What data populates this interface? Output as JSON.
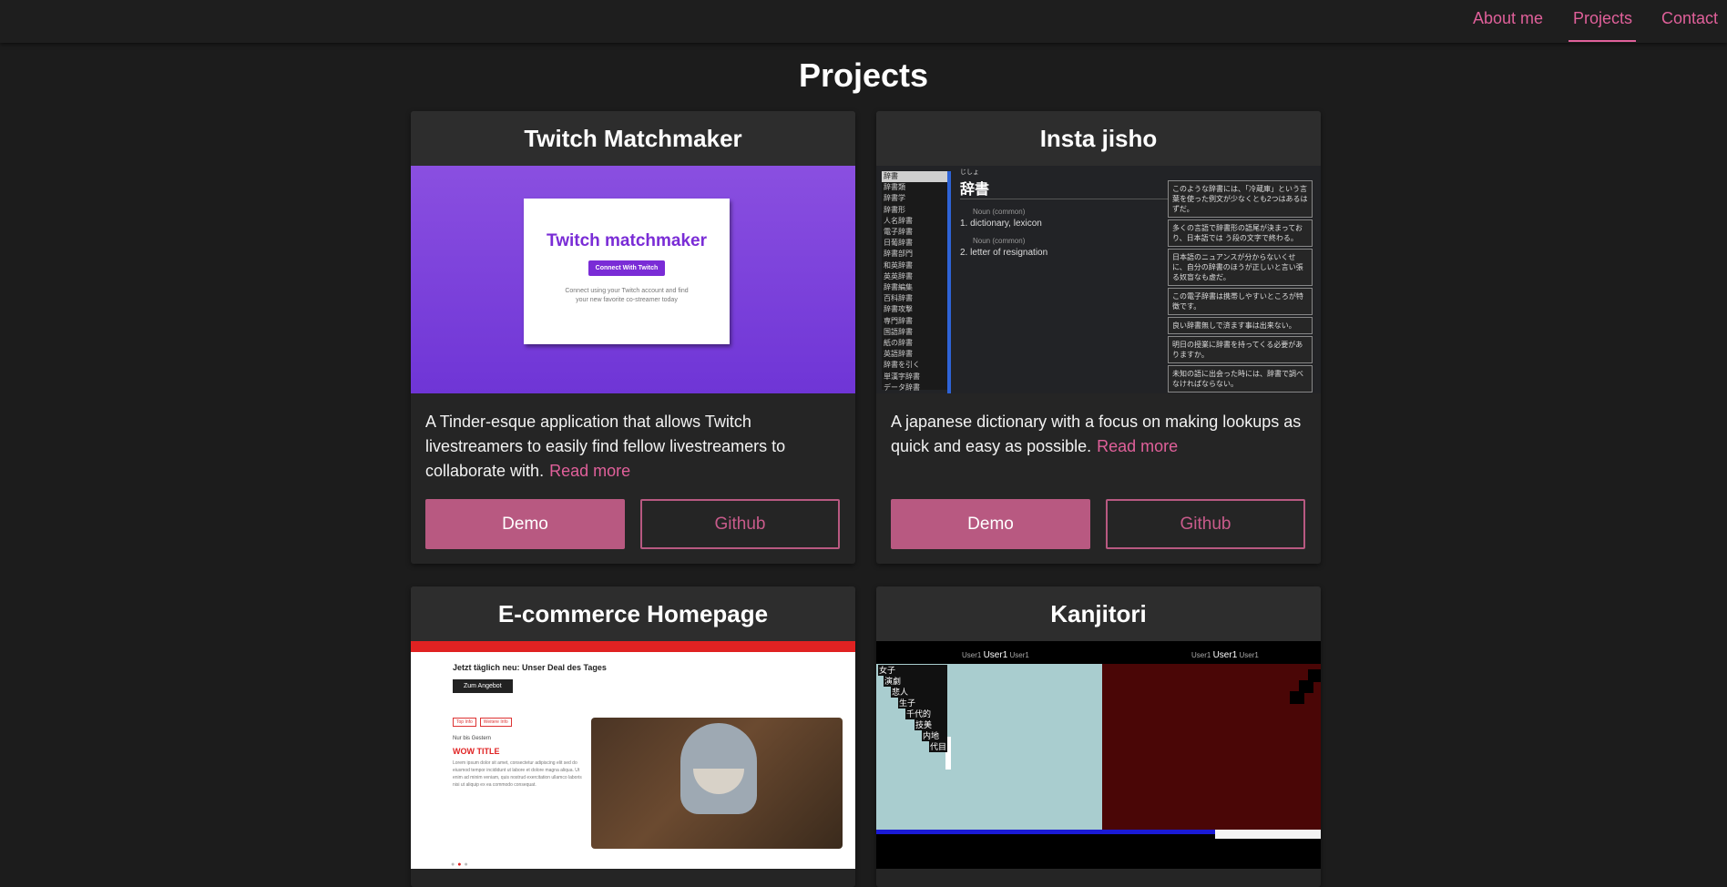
{
  "nav": {
    "items": [
      "About me",
      "Projects",
      "Contact"
    ],
    "active": "Projects",
    "accent_color": "#e0609a"
  },
  "page": {
    "title": "Projects"
  },
  "projects": [
    {
      "title": "Twitch Matchmaker",
      "description": "A Tinder-esque application that allows Twitch livestreamers to easily find fellow livestreamers to collaborate with.",
      "read_more": "Read more",
      "demo_label": "Demo",
      "github_label": "Github",
      "preview": {
        "heading": "Twitch matchmaker",
        "button": "Connect With Twitch",
        "subtext": "Connect using your Twitch account and find your new favorite co-streamer today"
      }
    },
    {
      "title": "Insta jisho",
      "description": "A japanese dictionary with a focus on making lookups as quick and easy as possible.",
      "read_more": "Read more",
      "demo_label": "Demo",
      "github_label": "Github",
      "preview": {
        "list": [
          "辞書",
          "辞書類",
          "辞書学",
          "辞書形",
          "人名辞書",
          "電子辞書",
          "日葡辞書",
          "辞書部門",
          "和英辞書",
          "英英辞書",
          "辞書編集",
          "百科辞書",
          "辞書攻撃",
          "専門辞書",
          "国語辞書",
          "紙の辞書",
          "英語辞書",
          "辞書を引く",
          "単漢字辞書",
          "データ辞書"
        ],
        "furigana": "じしょ",
        "word": "辞書",
        "pos1": "Noun (common)",
        "def1": "1. dictionary, lexicon",
        "pos2": "Noun (common)",
        "def2": "2. letter of resignation",
        "examples": [
          "このような辞書には、「冷蔵庫」という言葉を使った例文が少なくとも2つはあるはずだ。",
          "多くの言語で辞書形の語尾が決まっており、日本語では う段の文字で終わる。",
          "日本語のニュアンスが分からないくせに、自分の辞書のほうが正しいと言い張る奴盲なも虚だ。",
          "この電子辞書は携帯しやすいところが特徴です。",
          "良い辞書無しで済ます事は出来ない。",
          "明日の授業に辞書を持ってくる必要がありますか。",
          "未知の語に出会った時には、辞書で調べなければならない。"
        ]
      }
    },
    {
      "title": "E-commerce Homepage",
      "description": "",
      "read_more": "",
      "demo_label": "",
      "github_label": "",
      "preview": {
        "deal": "Jetzt täglich neu: Unser Deal des Tages",
        "deal_button": "Zum Angebot",
        "tags": [
          "Top Info",
          "Weitere Info"
        ],
        "until": "Nur bis Gestern",
        "wow": "WOW TITLE",
        "body": "Lorem ipsum dolor sit amet, consectetur adipiscing elit sed do eiusmod tempor incididunt ut labore et dolore magna aliqua. Ut enim ad minim veniam, quis nostrud exercitation ullamco laboris nisi ut aliquip ex ea commodo consequat."
      }
    },
    {
      "title": "Kanjitori",
      "description": "",
      "read_more": "",
      "demo_label": "",
      "github_label": "",
      "preview": {
        "left_user": "User1",
        "left_name": "User1",
        "left_user2": "User1",
        "right_user": "User1",
        "right_name": "User1",
        "right_user2": "User1",
        "chars": [
          "女子",
          "演劇",
          "悲人",
          "生子",
          "千代的",
          "技美",
          "内地",
          "代目"
        ]
      }
    }
  ]
}
